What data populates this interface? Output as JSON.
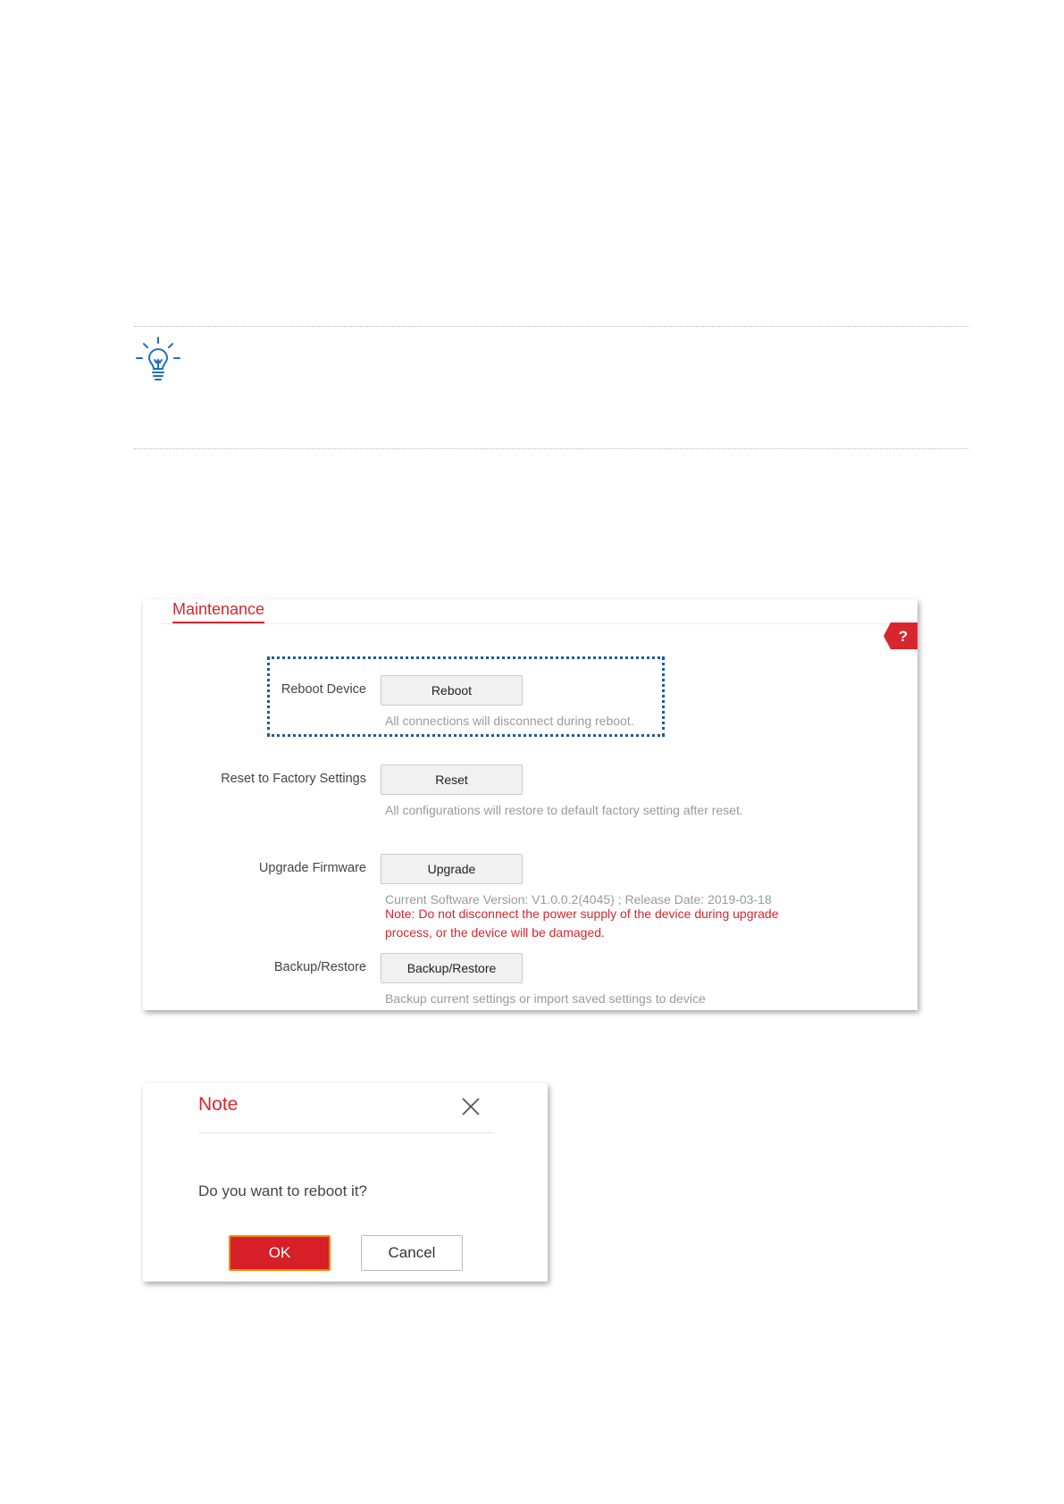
{
  "tip": {
    "icon": "lightbulb-icon"
  },
  "maintenance": {
    "title": "Maintenance",
    "help_icon": "help-icon",
    "help_label": "?",
    "accent_color": "#d7262e",
    "rows": {
      "reboot": {
        "label": "Reboot Device",
        "button": "Reboot",
        "hint": "All connections will disconnect during reboot."
      },
      "reset": {
        "label": "Reset to Factory Settings",
        "button": "Reset",
        "hint": "All configurations will restore to default factory setting after reset."
      },
      "upgrade": {
        "label": "Upgrade Firmware",
        "button": "Upgrade",
        "hint": "Current Software Version: V1.0.0.2(4045) ; Release Date: 2019-03-18",
        "warning_line1": "Note: Do not disconnect the power supply of the device during upgrade",
        "warning_line2": "process, or the device will be damaged."
      },
      "backup": {
        "label": "Backup/Restore",
        "button": "Backup/Restore",
        "hint": "Backup current settings or import saved settings to device"
      }
    }
  },
  "note_dialog": {
    "title": "Note",
    "close_icon": "close-icon",
    "message": "Do you want to reboot it?",
    "ok_label": "OK",
    "cancel_label": "Cancel"
  }
}
